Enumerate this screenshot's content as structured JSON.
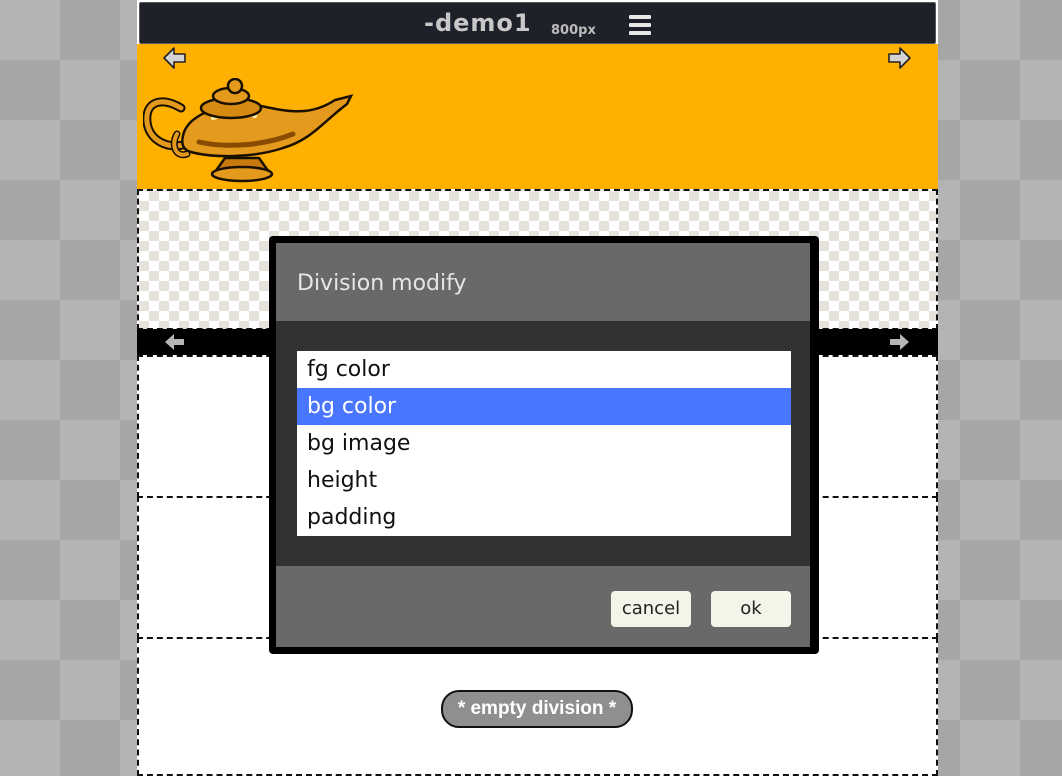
{
  "header": {
    "title": "-demo1",
    "width_label": "800px",
    "menu_icon": "hamburger-menu-icon"
  },
  "banner": {
    "background": "#ffb000",
    "prev_icon": "arrow-left-icon",
    "next_icon": "arrow-right-icon",
    "image": "magic-lamp"
  },
  "divider_bar": {
    "prev_icon": "arrow-left-icon",
    "next_icon": "arrow-right-icon"
  },
  "empty_division": {
    "label": "* empty division *"
  },
  "dialog": {
    "title": "Division modify",
    "options": [
      {
        "label": "fg color",
        "selected": false
      },
      {
        "label": "bg color",
        "selected": true
      },
      {
        "label": "bg image",
        "selected": false
      },
      {
        "label": "height",
        "selected": false
      },
      {
        "label": "padding",
        "selected": false
      }
    ],
    "cancel_label": "cancel",
    "ok_label": "ok",
    "selected_color": "#4a76ff"
  }
}
